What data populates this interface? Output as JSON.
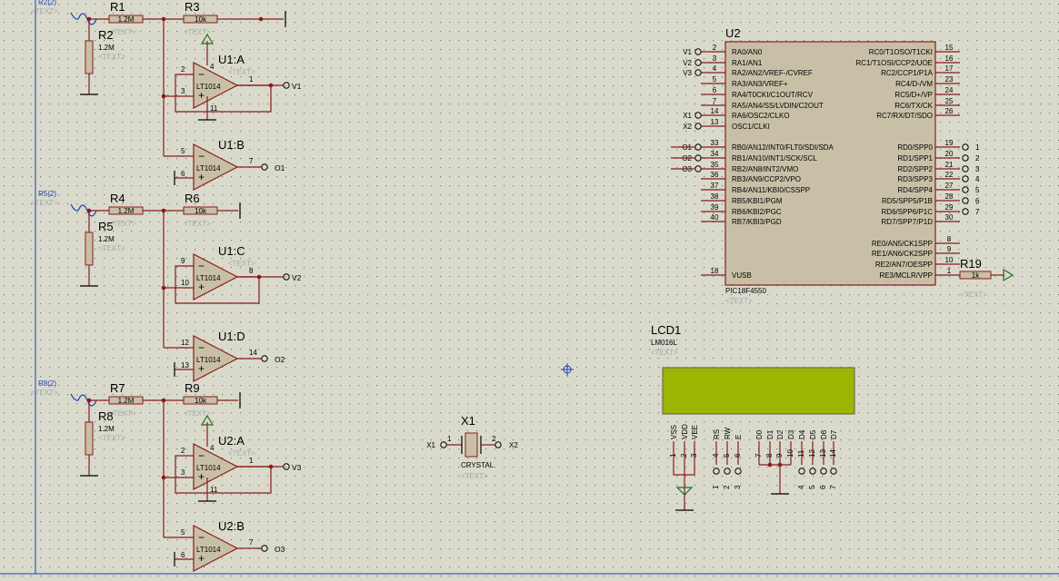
{
  "colors": {
    "background": "#d9dacc",
    "grid_dot": "#7a7a7a",
    "wire": "#8b1a1a",
    "component_fill": "#c8c0a6",
    "rail": "#1f3fb0",
    "lcd_screen": "#9db500",
    "placeholder_text": "#a8a8a8"
  },
  "text_placeholder": "<TEXT>",
  "channels": [
    {
      "terminal_label": "R2(2)",
      "series_resistor": {
        "name": "R1",
        "value": "1.2M"
      },
      "shunt_resistor": {
        "name": "R2",
        "value": "1.2M"
      },
      "feedback_resistor": {
        "name": "R3",
        "value": "10k"
      },
      "buffer": {
        "name": "U1:A",
        "part": "LT1014",
        "pin_plus": "3",
        "pin_minus": "2",
        "pin_out": "1",
        "pin_vplus": "4",
        "pin_vminus": "11",
        "output_label": "V1"
      },
      "comparator": {
        "name": "U1:B",
        "part": "LT1014",
        "pin_plus": "5",
        "pin_minus": "6",
        "pin_out": "7",
        "output_label": "O1"
      }
    },
    {
      "terminal_label": "R5(2)",
      "series_resistor": {
        "name": "R4",
        "value": "1.2M"
      },
      "shunt_resistor": {
        "name": "R5",
        "value": "1.2M"
      },
      "feedback_resistor": {
        "name": "R6",
        "value": "10k"
      },
      "buffer": {
        "name": "U1:C",
        "part": "LT1014",
        "pin_plus": "10",
        "pin_minus": "9",
        "pin_out": "8",
        "pin_vplus": "",
        "pin_vminus": "",
        "output_label": "V2"
      },
      "comparator": {
        "name": "U1:D",
        "part": "LT1014",
        "pin_plus": "12",
        "pin_minus": "13",
        "pin_out": "14",
        "output_label": "O2"
      }
    },
    {
      "terminal_label": "R8(2)",
      "series_resistor": {
        "name": "R7",
        "value": "1.2M"
      },
      "shunt_resistor": {
        "name": "R8",
        "value": "1.2M"
      },
      "feedback_resistor": {
        "name": "R9",
        "value": "10k"
      },
      "buffer": {
        "name": "U2:A",
        "part": "LT1014",
        "pin_plus": "3",
        "pin_minus": "2",
        "pin_out": "1",
        "pin_vplus": "4",
        "pin_vminus": "11",
        "output_label": "V3"
      },
      "comparator": {
        "name": "U2:B",
        "part": "LT1014",
        "pin_plus": "5",
        "pin_minus": "6",
        "pin_out": "7",
        "output_label": "O3"
      }
    }
  ],
  "mcu": {
    "ref": "U2",
    "part": "PIC18F4550",
    "left_pins": [
      {
        "num": "2",
        "name": "RA0/AN0",
        "net": "V1"
      },
      {
        "num": "3",
        "name": "RA1/AN1",
        "net": "V2"
      },
      {
        "num": "4",
        "name": "RA2/AN2/VREF-/CVREF",
        "net": "V3"
      },
      {
        "num": "5",
        "name": "RA3/AN3/VREF+",
        "net": ""
      },
      {
        "num": "6",
        "name": "RA4/T0CKI/C1OUT/RCV",
        "net": ""
      },
      {
        "num": "7",
        "name": "RA5/AN4/SS/LVDIN/C2OUT",
        "net": ""
      },
      {
        "num": "14",
        "name": "RA6/OSC2/CLKO",
        "net": "X1"
      },
      {
        "num": "13",
        "name": "OSC1/CLKI",
        "net": "X2"
      },
      {
        "num": "33",
        "name": "RB0/AN12/INT0/FLT0/SDI/SDA",
        "net": "O1"
      },
      {
        "num": "34",
        "name": "RB1/AN10/INT1/SCK/SCL",
        "net": "O2"
      },
      {
        "num": "35",
        "name": "RB2/AN8/INT2/VMO",
        "net": "O3"
      },
      {
        "num": "36",
        "name": "RB3/AN9/CCP2/VPO",
        "net": ""
      },
      {
        "num": "37",
        "name": "RB4/AN11/KBI0/CSSPP",
        "net": ""
      },
      {
        "num": "38",
        "name": "RB5/KBI1/PGM",
        "net": ""
      },
      {
        "num": "39",
        "name": "RB6/KBI2/PGC",
        "net": ""
      },
      {
        "num": "40",
        "name": "RB7/KBI3/PGD",
        "net": ""
      },
      {
        "num": "18",
        "name": "VUSB",
        "net": ""
      }
    ],
    "right_pins": [
      {
        "num": "15",
        "name": "RC0/T1OSO/T1CKI",
        "net": ""
      },
      {
        "num": "16",
        "name": "RC1/T1OSI/CCP2/UOE",
        "net": ""
      },
      {
        "num": "17",
        "name": "RC2/CCP1/P1A",
        "net": ""
      },
      {
        "num": "23",
        "name": "RC4/D-/VM",
        "net": ""
      },
      {
        "num": "24",
        "name": "RC5/D+/VP",
        "net": ""
      },
      {
        "num": "25",
        "name": "RC6/TX/CK",
        "net": ""
      },
      {
        "num": "26",
        "name": "RC7/RX/DT/SDO",
        "net": ""
      },
      {
        "num": "19",
        "name": "RD0/SPP0",
        "net": "1"
      },
      {
        "num": "20",
        "name": "RD1/SPP1",
        "net": "2"
      },
      {
        "num": "21",
        "name": "RD2/SPP2",
        "net": "3"
      },
      {
        "num": "22",
        "name": "RD3/SPP3",
        "net": "4"
      },
      {
        "num": "27",
        "name": "RD4/SPP4",
        "net": "5"
      },
      {
        "num": "28",
        "name": "RD5/SPP5/P1B",
        "net": "6"
      },
      {
        "num": "29",
        "name": "RD6/SPP6/P1C",
        "net": "7"
      },
      {
        "num": "30",
        "name": "RD7/SPP7/P1D",
        "net": ""
      },
      {
        "num": "8",
        "name": "RE0/AN5/CK1SPP",
        "net": ""
      },
      {
        "num": "9",
        "name": "RE1/AN6/CK2SPP",
        "net": ""
      },
      {
        "num": "10",
        "name": "RE2/AN7/OESPP",
        "net": ""
      },
      {
        "num": "1",
        "name": "RE3/MCLR/VPP",
        "net": ""
      }
    ]
  },
  "pullup": {
    "name": "R19",
    "value": "1k"
  },
  "crystal": {
    "ref": "X1",
    "part": "CRYSTAL",
    "left_net": "X1",
    "right_net": "X2",
    "pin_left": "1",
    "pin_right": "2"
  },
  "lcd": {
    "ref": "LCD1",
    "part": "LM016L",
    "pins": [
      {
        "name": "VSS",
        "num": "1"
      },
      {
        "name": "VDD",
        "num": "2"
      },
      {
        "name": "VEE",
        "num": "3"
      },
      {
        "name": "RS",
        "num": "4"
      },
      {
        "name": "RW",
        "num": "5"
      },
      {
        "name": "E",
        "num": "6"
      },
      {
        "name": "D0",
        "num": "7"
      },
      {
        "name": "D1",
        "num": "8"
      },
      {
        "name": "D2",
        "num": "9"
      },
      {
        "name": "D3",
        "num": "10"
      },
      {
        "name": "D4",
        "num": "11"
      },
      {
        "name": "D5",
        "num": "12"
      },
      {
        "name": "D6",
        "num": "13"
      },
      {
        "name": "D7",
        "num": "14"
      }
    ],
    "rs_labels": [
      "1",
      "2",
      "3"
    ],
    "data_labels": [
      "4",
      "5",
      "6",
      "7"
    ]
  }
}
